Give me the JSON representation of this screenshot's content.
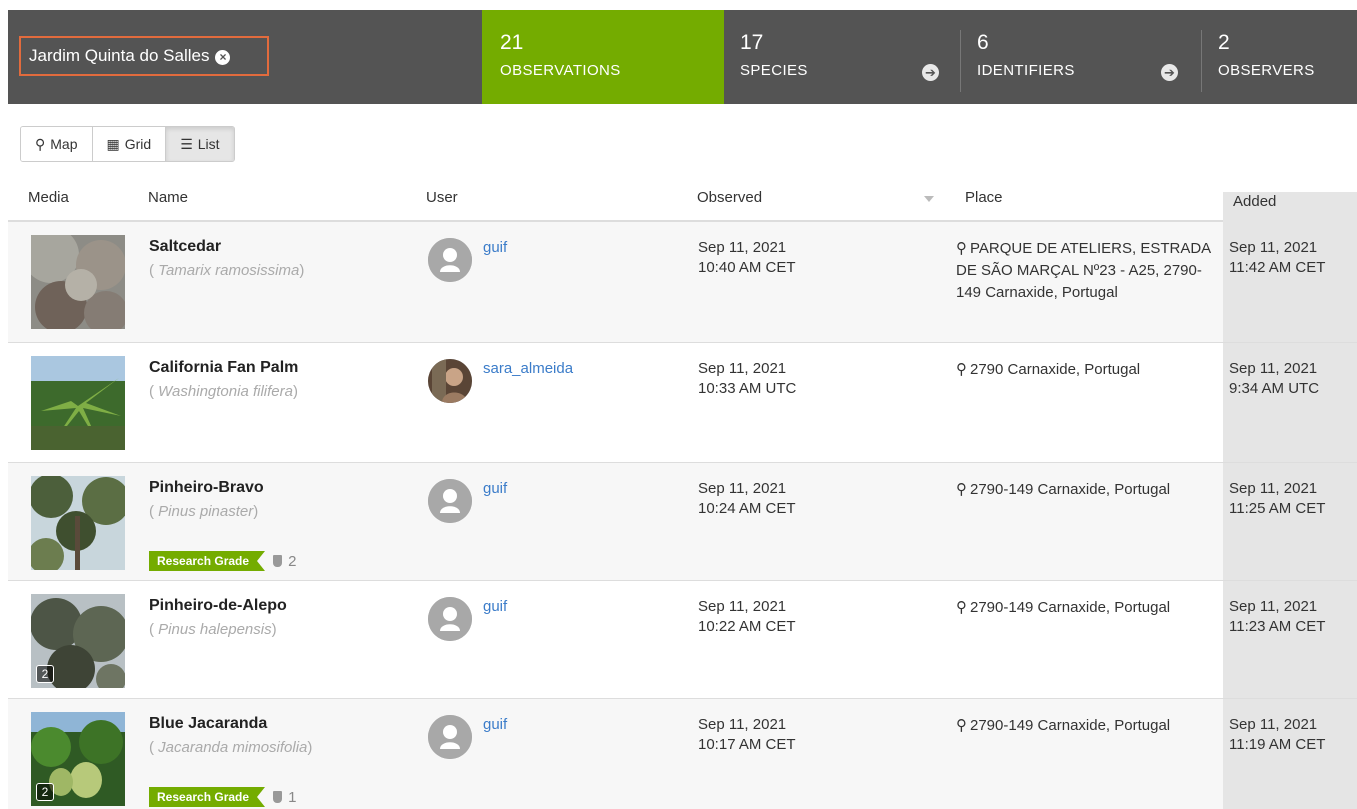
{
  "place_filter": {
    "label": "Jardim Quinta do Salles",
    "remove_icon": "close-circle-icon"
  },
  "stats": [
    {
      "count": "21",
      "label": "OBSERVATIONS"
    },
    {
      "count": "17",
      "label": "SPECIES"
    },
    {
      "count": "6",
      "label": "IDENTIFIERS"
    },
    {
      "count": "2",
      "label": "OBSERVERS"
    }
  ],
  "view_toggles": {
    "map": "Map",
    "grid": "Grid",
    "list": "List",
    "active": "List"
  },
  "columns": {
    "media": "Media",
    "name": "Name",
    "user": "User",
    "observed": "Observed",
    "place": "Place",
    "added": "Added"
  },
  "observations": [
    {
      "common_name": "Saltcedar",
      "scientific_name": "Tamarix ramosissima",
      "user": "guif",
      "observed_date": "Sep 11, 2021",
      "observed_time": "10:40 AM CET",
      "place": "PARQUE DE ATELIERS, ESTRADA DE SÃO MARÇAL Nº23 - A25, 2790-149 Carnaxide, Portugal",
      "added_date": "Sep 11, 2021",
      "added_time": "11:42 AM CET"
    },
    {
      "common_name": "California Fan Palm",
      "scientific_name": "Washingtonia filifera",
      "user": "sara_almeida",
      "observed_date": "Sep 11, 2021",
      "observed_time": "10:33 AM UTC",
      "place": "2790 Carnaxide, Portugal",
      "added_date": "Sep 11, 2021",
      "added_time": "9:34 AM UTC"
    },
    {
      "common_name": "Pinheiro-Bravo",
      "scientific_name": "Pinus pinaster",
      "user": "guif",
      "observed_date": "Sep 11, 2021",
      "observed_time": "10:24 AM CET",
      "place": "2790-149 Carnaxide, Portugal",
      "added_date": "Sep 11, 2021",
      "added_time": "11:25 AM CET",
      "quality": "Research Grade",
      "ids": "2"
    },
    {
      "common_name": "Pinheiro-de-Alepo",
      "scientific_name": "Pinus halepensis",
      "user": "guif",
      "observed_date": "Sep 11, 2021",
      "observed_time": "10:22 AM CET",
      "place": "2790-149 Carnaxide, Portugal",
      "added_date": "Sep 11, 2021",
      "added_time": "11:23 AM CET",
      "photo_count": "2"
    },
    {
      "common_name": "Blue Jacaranda",
      "scientific_name": "Jacaranda mimosifolia",
      "user": "guif",
      "observed_date": "Sep 11, 2021",
      "observed_time": "10:17 AM CET",
      "place": "2790-149 Carnaxide, Portugal",
      "added_date": "Sep 11, 2021",
      "added_time": "11:19 AM CET",
      "quality": "Research Grade",
      "ids": "1",
      "photo_count": "2"
    }
  ],
  "colors": {
    "topbar": "#545454",
    "accent": "#74ac00",
    "link": "#3b7cc9",
    "filter_border": "#e26b3d"
  }
}
